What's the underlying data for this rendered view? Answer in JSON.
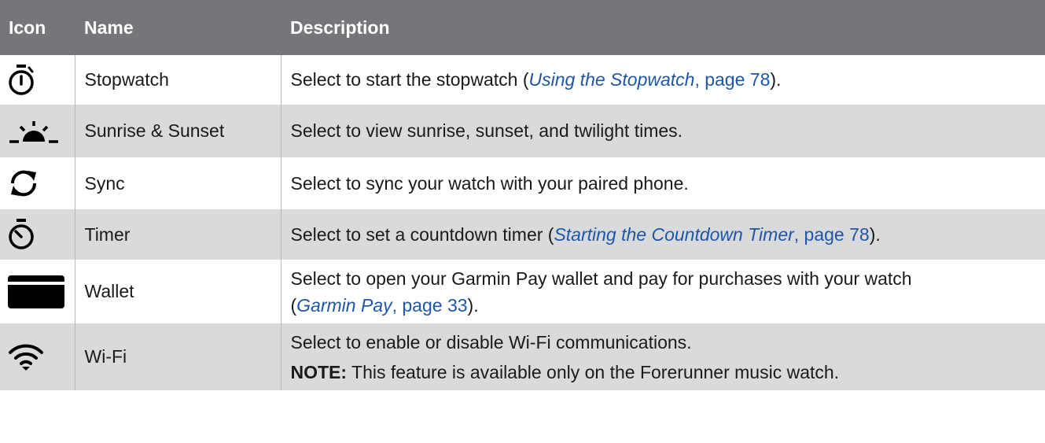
{
  "headers": {
    "icon": "Icon",
    "name": "Name",
    "description": "Description"
  },
  "rows": [
    {
      "icon": "stopwatch-icon",
      "name": "Stopwatch",
      "desc_before": "Select to start the stopwatch (",
      "link_title": "Using the Stopwatch",
      "link_page": ", page 78",
      "desc_after": ")."
    },
    {
      "icon": "sunrise-sunset-icon",
      "name": "Sunrise & Sunset",
      "desc": "Select to view sunrise, sunset, and twilight times."
    },
    {
      "icon": "sync-icon",
      "name": "Sync",
      "desc": "Select to sync your watch with your paired phone."
    },
    {
      "icon": "timer-icon",
      "name": "Timer",
      "desc_before": "Select to set a countdown timer (",
      "link_title": "Starting the Countdown Timer",
      "link_page": ", page 78",
      "desc_after": ")."
    },
    {
      "icon": "wallet-icon",
      "name": "Wallet",
      "desc_line1": "Select to open your Garmin Pay wallet and pay for purchases with your watch",
      "desc_before": "(",
      "link_title": "Garmin Pay",
      "link_page": ", page 33",
      "desc_after": ")."
    },
    {
      "icon": "wifi-icon",
      "name": "Wi-Fi",
      "desc": "Select to enable or disable Wi-Fi communications.",
      "note_label": "NOTE:",
      "note_text": " This feature is available only on the Forerunner music watch."
    }
  ],
  "colors": {
    "header_bg": "#747679",
    "alt_row_bg": "#d9dadb",
    "link": "#1e56a8",
    "icon": "#000000"
  }
}
